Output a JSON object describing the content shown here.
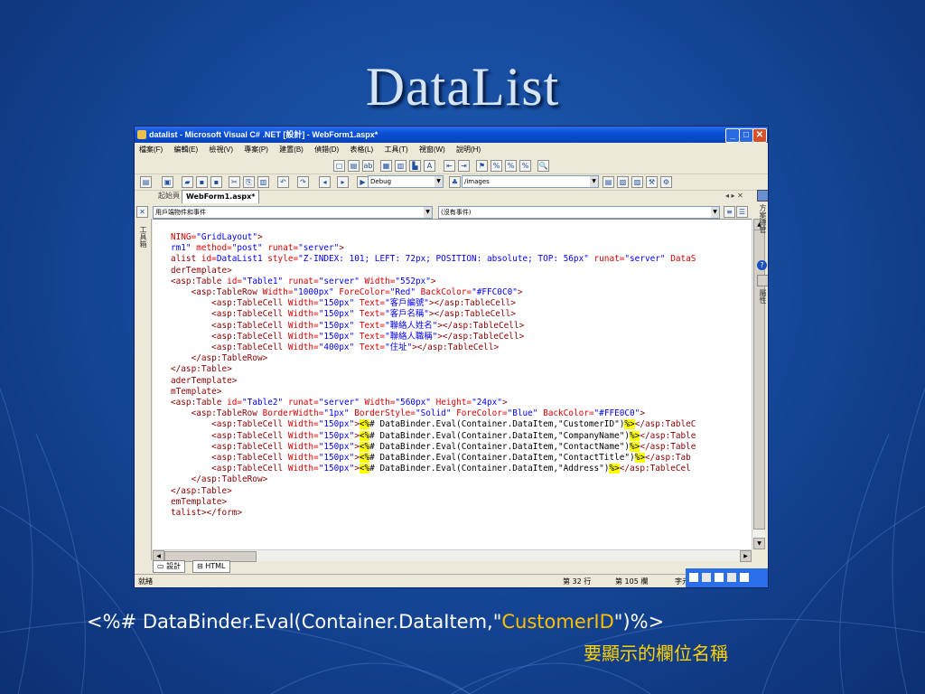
{
  "slide": {
    "title": "DataList",
    "caption_before": "<%# DataBinder.Eval(Container.DataItem,\"",
    "caption_highlight": "CustomerID",
    "caption_after": "\")%>",
    "caption_note": "要顯示的欄位名稱",
    "highlight_color": "#ffc000"
  },
  "window": {
    "title": "datalist - Microsoft Visual C# .NET [設計] - WebForm1.aspx*",
    "menu": [
      "檔案(F)",
      "編輯(E)",
      "檢視(V)",
      "專案(P)",
      "建置(B)",
      "偵錯(D)",
      "表格(L)",
      "工具(T)",
      "視窗(W)",
      "說明(H)"
    ],
    "config_combo": "Debug",
    "path_combo": "/images",
    "tabs": [
      "起始頁",
      "WebForm1.aspx*"
    ],
    "object_combo": "用戶端物件和事件",
    "event_combo": "(沒有事件)",
    "view_tabs": [
      "設計",
      "HTML"
    ],
    "status": {
      "ready": "就緒",
      "line": "第 32 行",
      "col": "第 105 欄",
      "ch": "字元"
    },
    "side_labels": {
      "toolbox": "工具箱",
      "solution": "方案總管",
      "props": "屬性"
    }
  },
  "code": [
    [
      [
        "NING=",
        "a"
      ],
      [
        "\"GridLayout\"",
        "v"
      ],
      [
        ">",
        "t"
      ]
    ],
    [
      [
        "rm1\" ",
        "v"
      ],
      [
        "method=",
        "a"
      ],
      [
        "\"post\" ",
        "v"
      ],
      [
        "runat=",
        "a"
      ],
      [
        "\"server\"",
        "v"
      ],
      [
        ">",
        "t"
      ]
    ],
    [
      [
        "alist ",
        "t"
      ],
      [
        "id=",
        "a"
      ],
      [
        "DataList1 ",
        "v"
      ],
      [
        "style=",
        "a"
      ],
      [
        "\"Z-INDEX: 101; LEFT: 72px; POSITION: absolute; TOP: 56px\" ",
        "v"
      ],
      [
        "runat=",
        "a"
      ],
      [
        "\"server\" ",
        "v"
      ],
      [
        "DataS",
        "a"
      ]
    ],
    [
      [
        "derTemplate>",
        "t"
      ]
    ],
    [
      [
        "<asp:Table ",
        "t"
      ],
      [
        "id=",
        "a"
      ],
      [
        "\"Table1\" ",
        "v"
      ],
      [
        "runat=",
        "a"
      ],
      [
        "\"server\" ",
        "v"
      ],
      [
        "Width=",
        "a"
      ],
      [
        "\"552px\"",
        "v"
      ],
      [
        ">",
        "t"
      ]
    ],
    [
      [
        "    <asp:TableRow ",
        "t"
      ],
      [
        "Width=",
        "a"
      ],
      [
        "\"1000px\" ",
        "v"
      ],
      [
        "ForeColor=",
        "a"
      ],
      [
        "\"Red\" ",
        "v"
      ],
      [
        "BackColor=",
        "a"
      ],
      [
        "\"#FFC0C0\"",
        "v"
      ],
      [
        ">",
        "t"
      ]
    ],
    [
      [
        "        <asp:TableCell ",
        "t"
      ],
      [
        "Width=",
        "a"
      ],
      [
        "\"150px\" ",
        "v"
      ],
      [
        "Text=",
        "a"
      ],
      [
        "\"客戶編號\"",
        "v"
      ],
      [
        "></asp:TableCell>",
        "t"
      ]
    ],
    [
      [
        "        <asp:TableCell ",
        "t"
      ],
      [
        "Width=",
        "a"
      ],
      [
        "\"150px\" ",
        "v"
      ],
      [
        "Text=",
        "a"
      ],
      [
        "\"客戶名稱\"",
        "v"
      ],
      [
        "></asp:TableCell>",
        "t"
      ]
    ],
    [
      [
        "        <asp:TableCell ",
        "t"
      ],
      [
        "Width=",
        "a"
      ],
      [
        "\"150px\" ",
        "v"
      ],
      [
        "Text=",
        "a"
      ],
      [
        "\"聯絡人姓名\"",
        "v"
      ],
      [
        "></asp:TableCell>",
        "t"
      ]
    ],
    [
      [
        "        <asp:TableCell ",
        "t"
      ],
      [
        "Width=",
        "a"
      ],
      [
        "\"150px\" ",
        "v"
      ],
      [
        "Text=",
        "a"
      ],
      [
        "\"聯絡人職稱\"",
        "v"
      ],
      [
        "></asp:TableCell>",
        "t"
      ]
    ],
    [
      [
        "        <asp:TableCell ",
        "t"
      ],
      [
        "Width=",
        "a"
      ],
      [
        "\"400px\" ",
        "v"
      ],
      [
        "Text=",
        "a"
      ],
      [
        "\"住址\"",
        "v"
      ],
      [
        "></asp:TableCell>",
        "t"
      ]
    ],
    [
      [
        "    </asp:TableRow>",
        "t"
      ]
    ],
    [
      [
        "</asp:Table>",
        "t"
      ]
    ],
    [
      [
        "aderTemplate>",
        "t"
      ]
    ],
    [
      [
        "mTemplate>",
        "t"
      ]
    ],
    [
      [
        "<asp:Table ",
        "t"
      ],
      [
        "id=",
        "a"
      ],
      [
        "\"Table2\" ",
        "v"
      ],
      [
        "runat=",
        "a"
      ],
      [
        "\"server\" ",
        "v"
      ],
      [
        "Width=",
        "a"
      ],
      [
        "\"560px\" ",
        "v"
      ],
      [
        "Height=",
        "a"
      ],
      [
        "\"24px\"",
        "v"
      ],
      [
        ">",
        "t"
      ]
    ],
    [
      [
        "    <asp:TableRow ",
        "t"
      ],
      [
        "BorderWidth=",
        "a"
      ],
      [
        "\"1px\" ",
        "v"
      ],
      [
        "BorderStyle=",
        "a"
      ],
      [
        "\"Solid\" ",
        "v"
      ],
      [
        "ForeColor=",
        "a"
      ],
      [
        "\"Blue\" ",
        "v"
      ],
      [
        "BackColor=",
        "a"
      ],
      [
        "\"#FFE0C0\"",
        "v"
      ],
      [
        ">",
        "t"
      ]
    ],
    [
      [
        "        <asp:TableCell ",
        "t"
      ],
      [
        "Width=",
        "a"
      ],
      [
        "\"150px\"",
        "v"
      ],
      [
        ">",
        "t"
      ],
      [
        "<%",
        "h"
      ],
      [
        "# DataBinder.Eval(Container.DataItem,\"CustomerID\")",
        "x"
      ],
      [
        "%>",
        "h"
      ],
      [
        "</asp:TableC",
        "t"
      ]
    ],
    [
      [
        "        <asp:TableCell ",
        "t"
      ],
      [
        "Width=",
        "a"
      ],
      [
        "\"150px\"",
        "v"
      ],
      [
        ">",
        "t"
      ],
      [
        "<%",
        "h"
      ],
      [
        "# DataBinder.Eval(Container.DataItem,\"CompanyName\")",
        "x"
      ],
      [
        "%>",
        "h"
      ],
      [
        "</asp:Table",
        "t"
      ]
    ],
    [
      [
        "        <asp:TableCell ",
        "t"
      ],
      [
        "Width=",
        "a"
      ],
      [
        "\"150px\"",
        "v"
      ],
      [
        ">",
        "t"
      ],
      [
        "<%",
        "h"
      ],
      [
        "# DataBinder.Eval(Container.DataItem,\"ContactName\")",
        "x"
      ],
      [
        "%>",
        "h"
      ],
      [
        "</asp:Table",
        "t"
      ]
    ],
    [
      [
        "        <asp:TableCell ",
        "t"
      ],
      [
        "Width=",
        "a"
      ],
      [
        "\"150px\"",
        "v"
      ],
      [
        ">",
        "t"
      ],
      [
        "<%",
        "h"
      ],
      [
        "# DataBinder.Eval(Container.DataItem,\"ContactTitle\")",
        "x"
      ],
      [
        "%>",
        "h"
      ],
      [
        "</asp:Tab",
        "t"
      ]
    ],
    [
      [
        "        <asp:TableCell ",
        "t"
      ],
      [
        "Width=",
        "a"
      ],
      [
        "\"150px\"",
        "v"
      ],
      [
        ">",
        "t"
      ],
      [
        "<%",
        "h"
      ],
      [
        "# DataBinder.Eval(Container.DataItem,\"Address\")",
        "x"
      ],
      [
        "%>",
        "h"
      ],
      [
        "</asp:TableCel",
        "t"
      ]
    ],
    [
      [
        "    </asp:TableRow>",
        "t"
      ]
    ],
    [
      [
        "</asp:Table>",
        "t"
      ]
    ],
    [
      [
        "emTemplate>",
        "t"
      ]
    ],
    [
      [
        "talist></form>",
        "t"
      ]
    ]
  ]
}
